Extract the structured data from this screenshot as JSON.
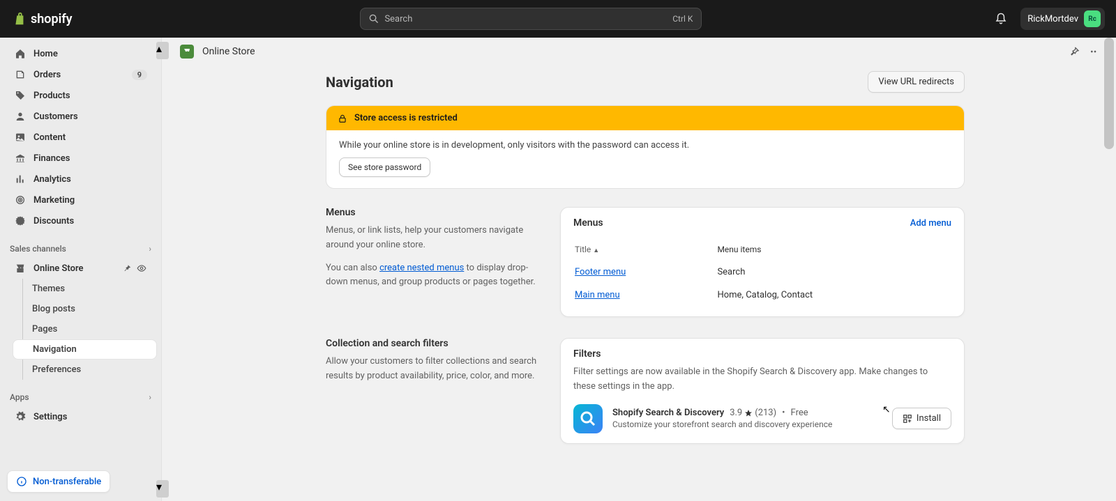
{
  "header": {
    "brand": "shopify",
    "search_placeholder": "Search",
    "shortcut": "Ctrl K",
    "username": "RickMortdev",
    "avatar_initials": "Rc"
  },
  "sidebar": {
    "items": [
      {
        "label": "Home"
      },
      {
        "label": "Orders",
        "badge": "9"
      },
      {
        "label": "Products"
      },
      {
        "label": "Customers"
      },
      {
        "label": "Content"
      },
      {
        "label": "Finances"
      },
      {
        "label": "Analytics"
      },
      {
        "label": "Marketing"
      },
      {
        "label": "Discounts"
      }
    ],
    "sales_channels_title": "Sales channels",
    "online_store_label": "Online Store",
    "sub_items": [
      {
        "label": "Themes"
      },
      {
        "label": "Blog posts"
      },
      {
        "label": "Pages"
      },
      {
        "label": "Navigation"
      },
      {
        "label": "Preferences"
      }
    ],
    "apps_title": "Apps",
    "settings_label": "Settings",
    "footer_pill": "Non-transferable"
  },
  "crumb": {
    "label": "Online Store"
  },
  "page": {
    "title": "Navigation",
    "view_redirects": "View URL redirects",
    "banner_title": "Store access is restricted",
    "banner_body": "While your online store is in development, only visitors with the password can access it.",
    "banner_button": "See store password",
    "menus_heading": "Menus",
    "menus_desc": "Menus, or link lists, help your customers navigate around your online store.",
    "menus_nested_prefix": "You can also ",
    "menus_nested_link": "create nested menus",
    "menus_nested_suffix": " to display drop-down menus, and group products or pages together.",
    "card_menus_title": "Menus",
    "add_menu": "Add menu",
    "col_title": "Title",
    "col_items": "Menu items",
    "menu_rows": [
      {
        "title": "Footer menu",
        "items": "Search"
      },
      {
        "title": "Main menu",
        "items": "Home, Catalog, Contact"
      }
    ],
    "filters_heading": "Collection and search filters",
    "filters_desc": "Allow your customers to filter collections and search results by product availability, price, color, and more.",
    "filters_card_title": "Filters",
    "filters_card_body": "Filter settings are now available in the Shopify Search & Discovery app. Make changes to these settings in the app.",
    "app_name": "Shopify Search & Discovery",
    "app_rating": "3.9",
    "app_reviews": "(213)",
    "app_dot": "•",
    "app_price": "Free",
    "app_tagline": "Customize your storefront search and discovery experience",
    "install": "Install"
  }
}
